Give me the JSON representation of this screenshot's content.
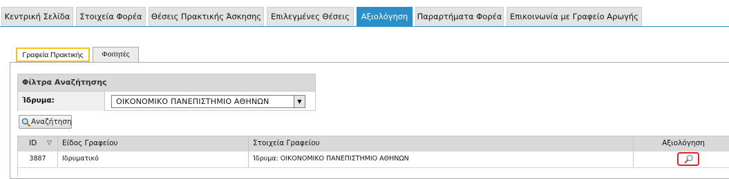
{
  "nav": {
    "tabs": [
      {
        "label": "Κεντρική Σελίδα"
      },
      {
        "label": "Στοιχεία Φορέα"
      },
      {
        "label": "Θέσεις Πρακτικής Άσκησης"
      },
      {
        "label": "Επιλεγμένες Θέσεις"
      },
      {
        "label": "Αξιολόγηση"
      },
      {
        "label": "Παραρτήματα Φορέα"
      },
      {
        "label": "Επικοινωνία με Γραφείο Αρωγής"
      }
    ],
    "active_color": "#2a8fc9"
  },
  "subtabs": [
    {
      "label": "Γραφεία Πρακτικής"
    },
    {
      "label": "Φοιτητές"
    }
  ],
  "filters": {
    "title": "Φίλτρα Αναζήτησης",
    "institution_label": "Ίδρυμα:",
    "institution_value": "ΟΙΚΟΝΟΜΙΚΟ ΠΑΝΕΠΙΣΤΗΜΙΟ ΑΘΗΝΩΝ"
  },
  "search_button": {
    "label": "Αναζήτηση"
  },
  "table": {
    "columns": [
      "ID",
      "Είδος Γραφείου",
      "Στοιχεία Γραφείου",
      "Αξιολόγηση"
    ],
    "rows": [
      {
        "id": "3887",
        "type": "Ιδρυματικό",
        "info": "Ίδρυμα: ΟΙΚΟΝΟΜΙΚΟ ΠΑΝΕΠΙΣΤΗΜΙΟ ΑΘΗΝΩΝ"
      }
    ]
  },
  "highlight_colors": {
    "active_subtab": "#f4c21b",
    "evaluate_button": "#d8232a"
  }
}
